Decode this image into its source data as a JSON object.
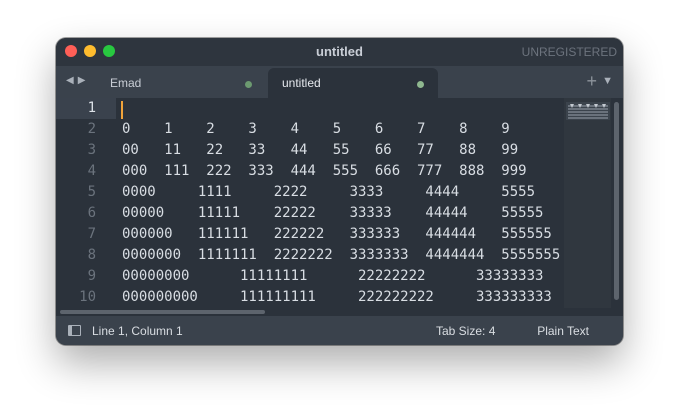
{
  "window": {
    "title": "untitled",
    "registration": "UNREGISTERED"
  },
  "tabs": [
    {
      "label": "Emad",
      "active": false,
      "modified": true
    },
    {
      "label": "untitled",
      "active": true,
      "modified": true
    }
  ],
  "icons": {
    "nav_back": "◀",
    "nav_forward": "▶",
    "new_tab": "+",
    "tab_menu": "▼"
  },
  "editor": {
    "lines": [
      "",
      "0    1    2    3    4    5    6    7    8    9",
      "00   11   22   33   44   55   66   77   88   99",
      "000  111  222  333  444  555  666  777  888  999",
      "0000     1111     2222     3333     4444     5555",
      "00000    11111    22222    33333    44444    55555",
      "000000   111111   222222   333333   444444   555555",
      "0000000  1111111  2222222  3333333  4444444  5555555",
      "00000000      11111111      22222222      33333333",
      "000000000     111111111     222222222     333333333"
    ],
    "line_numbers": [
      "1",
      "2",
      "3",
      "4",
      "5",
      "6",
      "7",
      "8",
      "9",
      "10"
    ],
    "current_line": 1
  },
  "status": {
    "position": "Line 1, Column 1",
    "tab_size": "Tab Size: 4",
    "syntax": "Plain Text"
  },
  "colors": {
    "accent_caret": "#f0a33a",
    "background": "#2b323b",
    "modified_dot": "#8fb88f"
  }
}
